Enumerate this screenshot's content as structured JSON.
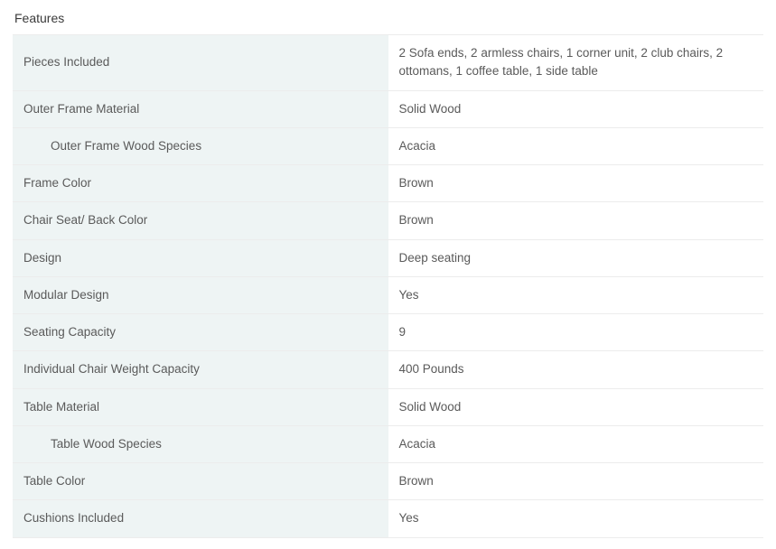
{
  "section_title": "Features",
  "rows": [
    {
      "label": "Pieces Included",
      "value": "2 Sofa ends, 2 armless chairs, 1 corner unit, 2 club chairs, 2 ottomans, 1 coffee table, 1 side table",
      "indent": false
    },
    {
      "label": "Outer Frame Material",
      "value": "Solid Wood",
      "indent": false
    },
    {
      "label": "Outer Frame Wood Species",
      "value": "Acacia",
      "indent": true
    },
    {
      "label": "Frame Color",
      "value": "Brown",
      "indent": false
    },
    {
      "label": "Chair Seat/ Back Color",
      "value": "Brown",
      "indent": false
    },
    {
      "label": "Design",
      "value": "Deep seating",
      "indent": false
    },
    {
      "label": "Modular Design",
      "value": "Yes",
      "indent": false
    },
    {
      "label": "Seating Capacity",
      "value": "9",
      "indent": false
    },
    {
      "label": "Individual Chair Weight Capacity",
      "value": "400 Pounds",
      "indent": false
    },
    {
      "label": "Table Material",
      "value": "Solid Wood",
      "indent": false
    },
    {
      "label": "Table Wood Species",
      "value": "Acacia",
      "indent": true
    },
    {
      "label": "Table Color",
      "value": "Brown",
      "indent": false
    },
    {
      "label": "Cushions Included",
      "value": "Yes",
      "indent": false
    }
  ]
}
